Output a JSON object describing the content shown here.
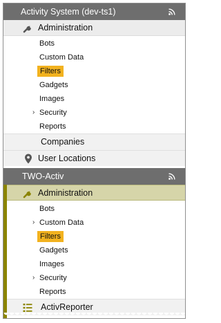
{
  "sections": [
    {
      "title": "Activity System (dev-ts1)",
      "rss_icon": "rss-icon",
      "admin_label": "Administration",
      "items": [
        {
          "label": "Bots",
          "expandable": false,
          "selected": false
        },
        {
          "label": "Custom Data",
          "expandable": false,
          "selected": false
        },
        {
          "label": "Filters",
          "expandable": false,
          "selected": true
        },
        {
          "label": "Gadgets",
          "expandable": false,
          "selected": false
        },
        {
          "label": "Images",
          "expandable": false,
          "selected": false
        },
        {
          "label": "Security",
          "expandable": true,
          "selected": false
        },
        {
          "label": "Reports",
          "expandable": false,
          "selected": false
        }
      ],
      "companies_label": "Companies",
      "user_locations_label": "User Locations"
    },
    {
      "title": "TWO-Activ",
      "rss_icon": "rss-icon",
      "admin_label": "Administration",
      "items": [
        {
          "label": "Bots",
          "expandable": false,
          "selected": false
        },
        {
          "label": "Custom Data",
          "expandable": true,
          "selected": false
        },
        {
          "label": "Filters",
          "expandable": false,
          "selected": true
        },
        {
          "label": "Gadgets",
          "expandable": false,
          "selected": false
        },
        {
          "label": "Images",
          "expandable": false,
          "selected": false
        },
        {
          "label": "Security",
          "expandable": true,
          "selected": false
        },
        {
          "label": "Reports",
          "expandable": false,
          "selected": false
        }
      ],
      "activreporter_label": "ActivReporter"
    }
  ],
  "colors": {
    "header_bg": "#6e6e6e",
    "selected_bg": "#f2b21f",
    "active_admin_bg": "#d6d5a9",
    "accent_bar": "#8b8400"
  },
  "chevron": "›"
}
